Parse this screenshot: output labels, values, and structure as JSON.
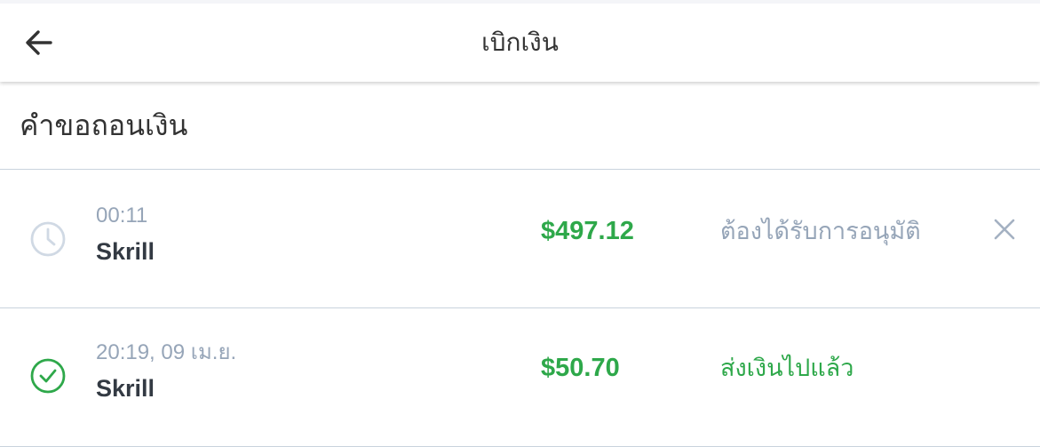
{
  "header": {
    "title": "เบิกเงิน",
    "back_icon": "arrow-left-icon"
  },
  "section": {
    "title": "คำขอถอนเงิน"
  },
  "requests": [
    {
      "time": "00:11",
      "method": "Skrill",
      "amount": "$497.12",
      "status": "ต้องได้รับการอนุมัติ",
      "status_icon": "clock-icon",
      "status_color": "#96a5b8",
      "cancel_icon": "close-icon"
    },
    {
      "time": "20:19, 09 เม.ย.",
      "method": "Skrill",
      "amount": "$50.70",
      "status": "ส่งเงินไปแล้ว",
      "status_icon": "check-circle-icon",
      "status_color": "#2ea84a"
    }
  ],
  "colors": {
    "amount": "#2ea84a",
    "muted": "#96a5b8",
    "text": "#333a43",
    "divider": "#c9d3dd"
  }
}
